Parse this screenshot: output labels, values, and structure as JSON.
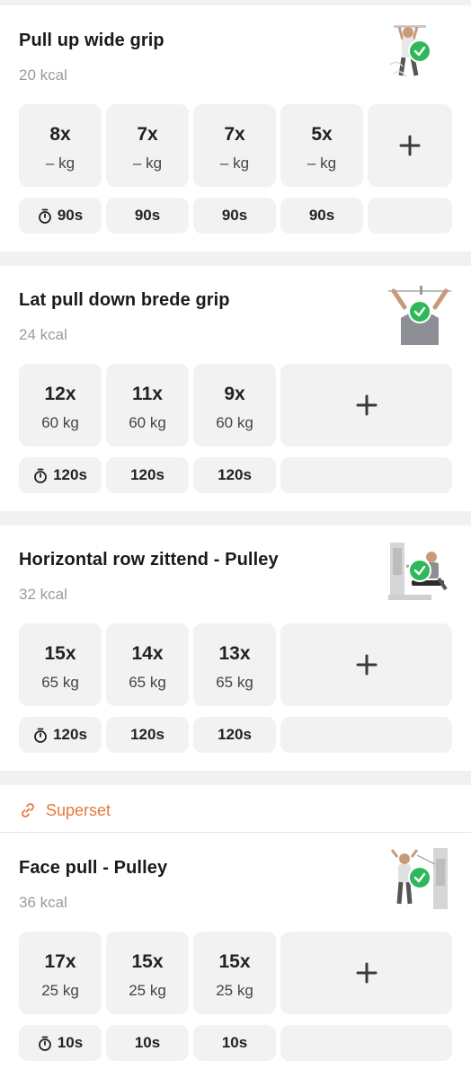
{
  "exercises": [
    {
      "name": "Pull up wide grip",
      "kcal": "20 kcal",
      "sets": [
        {
          "reps": "8x",
          "weight": "– kg",
          "rest": "90s"
        },
        {
          "reps": "7x",
          "weight": "– kg",
          "rest": "90s"
        },
        {
          "reps": "7x",
          "weight": "– kg",
          "rest": "90s"
        },
        {
          "reps": "5x",
          "weight": "– kg",
          "rest": "90s"
        }
      ],
      "completed": true
    },
    {
      "name": "Lat pull down brede grip",
      "kcal": "24 kcal",
      "sets": [
        {
          "reps": "12x",
          "weight": "60 kg",
          "rest": "120s"
        },
        {
          "reps": "11x",
          "weight": "60 kg",
          "rest": "120s"
        },
        {
          "reps": "9x",
          "weight": "60 kg",
          "rest": "120s"
        }
      ],
      "completed": true
    },
    {
      "name": "Horizontal row zittend - Pulley",
      "kcal": "32 kcal",
      "sets": [
        {
          "reps": "15x",
          "weight": "65 kg",
          "rest": "120s"
        },
        {
          "reps": "14x",
          "weight": "65 kg",
          "rest": "120s"
        },
        {
          "reps": "13x",
          "weight": "65 kg",
          "rest": "120s"
        }
      ],
      "completed": true
    },
    {
      "name": "Face pull - Pulley",
      "kcal": "36 kcal",
      "sets": [
        {
          "reps": "17x",
          "weight": "25 kg",
          "rest": "10s"
        },
        {
          "reps": "15x",
          "weight": "25 kg",
          "rest": "10s"
        },
        {
          "reps": "15x",
          "weight": "25 kg",
          "rest": "10s"
        }
      ],
      "completed": true
    }
  ],
  "superset_label": "Superset",
  "add_set_symbol": "+",
  "icons": {
    "rest": "stopwatch-icon",
    "add": "plus-icon",
    "done": "checkmark-icon",
    "superset": "link-icon"
  },
  "colors": {
    "accent": "#e8763c",
    "done": "#2fb85a",
    "cell": "#f2f2f2",
    "divider": "#f1f1f1"
  }
}
